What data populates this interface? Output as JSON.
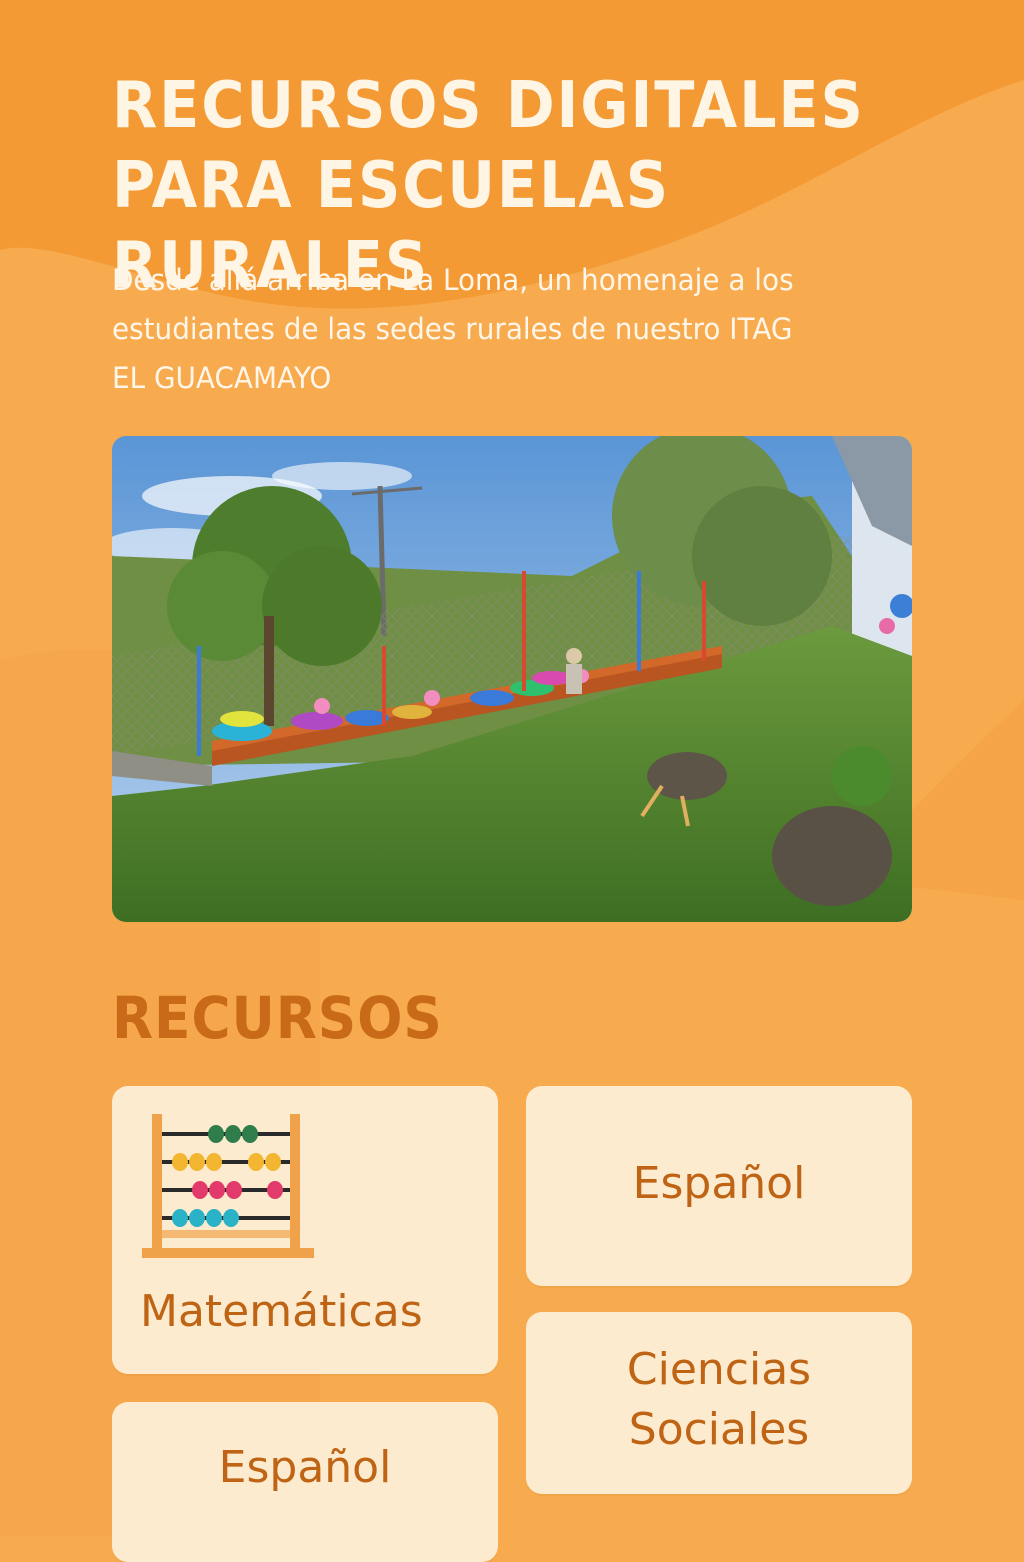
{
  "header": {
    "title_line1": "RECURSOS DIGITALES",
    "title_line2": "PARA ESCUELAS RURALES",
    "subtitle_line1": "Desde allá arriba en La Loma, un homenaje a los",
    "subtitle_line2": "estudiantes de las sedes rurales de nuestro ITAG",
    "subtitle_line3": "EL GUACAMAYO"
  },
  "hero_image": {
    "description_icon": "school-garden-photo"
  },
  "resources": {
    "heading": "RECURSOS",
    "cards": [
      {
        "label": "Matemáticas",
        "icon": "abacus-icon"
      },
      {
        "label": "Español"
      },
      {
        "label_line1": "Ciencias",
        "label_line2": "Sociales"
      },
      {
        "label": "Español"
      }
    ]
  },
  "colors": {
    "background": "#f7ab4e",
    "title": "#fff5e4",
    "accent": "#c86a17",
    "card": "#fdebcf"
  }
}
